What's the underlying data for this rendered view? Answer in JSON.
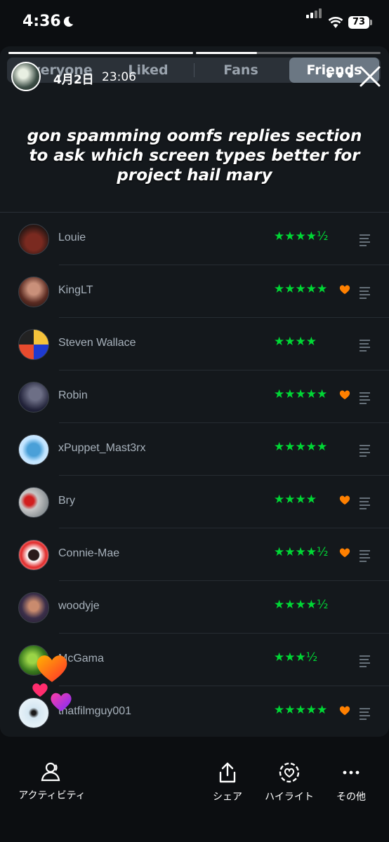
{
  "status": {
    "time": "4:36",
    "battery": "73"
  },
  "tabs": [
    "Everyone",
    "Liked",
    "Fans",
    "Friends"
  ],
  "story": {
    "date": "4月2日",
    "time": "23:06",
    "progress": [
      1.0,
      0.33
    ]
  },
  "caption": "gon spamming oomfs replies section to ask which screen types better for project hail mary",
  "rows": [
    {
      "name": "Louie",
      "stars": "★★★★½",
      "liked": false,
      "review": true
    },
    {
      "name": "KingLT",
      "stars": "★★★★★",
      "liked": true,
      "review": true
    },
    {
      "name": "Steven Wallace",
      "stars": "★★★★",
      "liked": false,
      "review": true
    },
    {
      "name": "Robin",
      "stars": "★★★★★",
      "liked": true,
      "review": true
    },
    {
      "name": "xPuppet_Mast3rx",
      "stars": "★★★★★",
      "liked": false,
      "review": true
    },
    {
      "name": "Bry",
      "stars": "★★★★",
      "liked": true,
      "review": true
    },
    {
      "name": "Connie-Mae",
      "stars": "★★★★½",
      "liked": true,
      "review": true
    },
    {
      "name": "woodyje",
      "stars": "★★★★½",
      "liked": false,
      "review": false
    },
    {
      "name": "McGama",
      "stars": "★★★½",
      "liked": false,
      "review": true
    },
    {
      "name": "thatfilmguy001",
      "stars": "★★★★★",
      "liked": true,
      "review": true
    }
  ],
  "bottom": {
    "activity": "アクティビティ",
    "share": "シェア",
    "highlight": "ハイライト",
    "more": "その他"
  },
  "colors": {
    "star": "#00d735",
    "heart": "#ff8000",
    "background": "#14181c"
  },
  "icons": [
    "moon-icon",
    "signal-icon",
    "wifi-icon",
    "close-icon",
    "heart-icon",
    "review-lines-icon",
    "people-icon",
    "share-icon",
    "highlight-icon",
    "more-icon"
  ]
}
